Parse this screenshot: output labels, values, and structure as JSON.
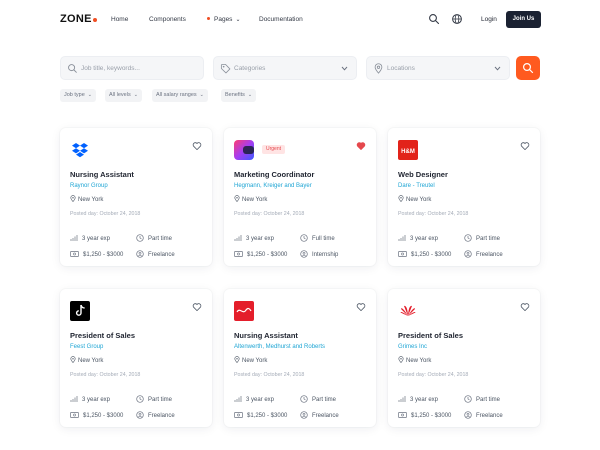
{
  "nav": {
    "logo": "ZONE",
    "links": [
      "Home",
      "Components",
      "Pages",
      "Documentation"
    ],
    "login": "Login",
    "join": "Join Us"
  },
  "search": {
    "keywords_placeholder": "Job title, keywords...",
    "categories_placeholder": "Categories",
    "locations_placeholder": "Locations"
  },
  "filters": [
    "Job type",
    "All levels",
    "All salary ranges",
    "Benefits"
  ],
  "accent_color": "#ff5a1f",
  "link_color": "#1fa5d4",
  "jobs": [
    {
      "logo": "dropbox-logo",
      "title": "Nursing Assistant",
      "company": "Raynor Group",
      "location": "New York",
      "posted": "Posted day: October 24, 2018",
      "experience": "3 year exp",
      "type": "Part time",
      "salary": "$1,250 - $3000",
      "work": "Freelance",
      "favorite": false,
      "urgent": false
    },
    {
      "logo": "gradient-logo",
      "title": "Marketing Coordinator",
      "company": "Hegmann, Kreiger and Bayer",
      "location": "New York",
      "posted": "Posted day: October 24, 2018",
      "experience": "3 year exp",
      "type": "Full time",
      "salary": "$1,250 - $3000",
      "work": "Internship",
      "favorite": true,
      "urgent": true,
      "badge": "Urgent"
    },
    {
      "logo": "hm-logo",
      "title": "Web Designer",
      "company": "Dare - Treutel",
      "location": "New York",
      "posted": "Posted day: October 24, 2018",
      "experience": "3 year exp",
      "type": "Part time",
      "salary": "$1,250 - $3000",
      "work": "Freelance",
      "favorite": false,
      "urgent": false
    },
    {
      "logo": "tiktok-logo",
      "title": "President of Sales",
      "company": "Feest Group",
      "location": "New York",
      "posted": "Posted day: October 24, 2018",
      "experience": "3 year exp",
      "type": "Part time",
      "salary": "$1,250 - $3000",
      "work": "Freelance",
      "favorite": false,
      "urgent": false
    },
    {
      "logo": "cocacola-logo",
      "title": "Nursing Assistant",
      "company": "Altenwerth, Medhurst and Roberts",
      "location": "New York",
      "posted": "Posted day: October 24, 2018",
      "experience": "3 year exp",
      "type": "Part time",
      "salary": "$1,250 - $3000",
      "work": "Freelance",
      "favorite": false,
      "urgent": false
    },
    {
      "logo": "huawei-logo",
      "title": "President of Sales",
      "company": "Grimes Inc",
      "location": "New York",
      "posted": "Posted day: October 24, 2018",
      "experience": "3 year exp",
      "type": "Part time",
      "salary": "$1,250 - $3000",
      "work": "Freelance",
      "favorite": false,
      "urgent": false
    }
  ]
}
